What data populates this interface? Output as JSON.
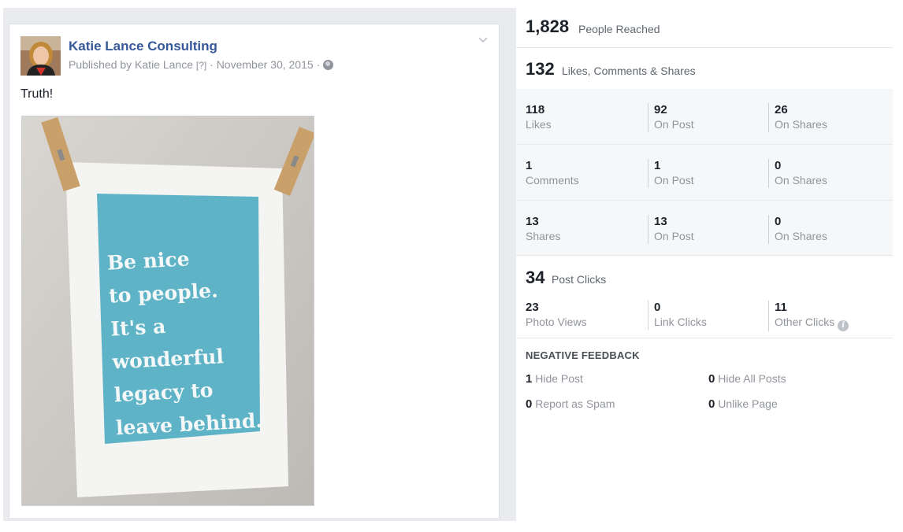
{
  "post": {
    "page_name": "Katie Lance Consulting",
    "published_prefix": "Published by Katie Lance",
    "help_marker": "[?]",
    "separator": "·",
    "date": "November 30, 2015",
    "privacy_icon": "globe-icon",
    "menu_icon": "chevron-down-icon",
    "text": "Truth!",
    "photo_lines": [
      "Be nice",
      "to people.",
      "It's a",
      "wonderful",
      "legacy to",
      "leave behind."
    ]
  },
  "insights": {
    "reach": {
      "value": "1,828",
      "label": "People Reached"
    },
    "engagement": {
      "value": "132",
      "label": "Likes, Comments & Shares"
    },
    "likes_row": [
      {
        "value": "118",
        "label": "Likes"
      },
      {
        "value": "92",
        "label": "On Post"
      },
      {
        "value": "26",
        "label": "On Shares"
      }
    ],
    "comments_row": [
      {
        "value": "1",
        "label": "Comments"
      },
      {
        "value": "1",
        "label": "On Post"
      },
      {
        "value": "0",
        "label": "On Shares"
      }
    ],
    "shares_row": [
      {
        "value": "13",
        "label": "Shares"
      },
      {
        "value": "13",
        "label": "On Post"
      },
      {
        "value": "0",
        "label": "On Shares"
      }
    ],
    "clicks": {
      "value": "34",
      "label": "Post Clicks"
    },
    "clicks_row": [
      {
        "value": "23",
        "label": "Photo Views"
      },
      {
        "value": "0",
        "label": "Link Clicks"
      },
      {
        "value": "11",
        "label": "Other Clicks"
      }
    ],
    "info_icon": "i",
    "negative": {
      "title": "NEGATIVE FEEDBACK",
      "items": [
        {
          "value": "1",
          "label": "Hide Post"
        },
        {
          "value": "0",
          "label": "Hide All Posts"
        },
        {
          "value": "0",
          "label": "Report as Spam"
        },
        {
          "value": "0",
          "label": "Unlike Page"
        }
      ]
    }
  },
  "colors": {
    "link": "#365899",
    "poster": "#5fb3c6",
    "muted": "#90949c"
  }
}
